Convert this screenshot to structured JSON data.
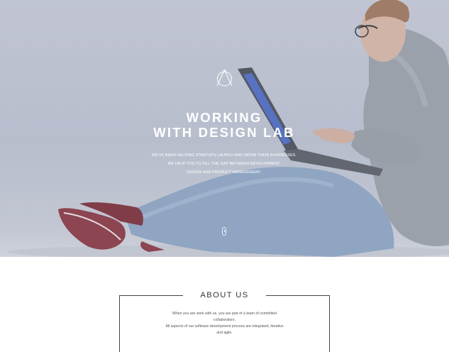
{
  "hero": {
    "title_line1": "WORKING",
    "title_line2": "WITH DESIGN LAB",
    "subtitle_lines": [
      "WE'VE BEEN HELPING STARTUPS LAUNCH AND GROW THEIR BUSINESSES.",
      "WE HELP YOU TO FILL THE GAP BETWEEN DEVELOPMENT,",
      "DESIGN AND PRODUCT MANAGEMENT."
    ],
    "logo_icon": "triangle-circle-logo-icon",
    "scroll_icon": "mouse-scroll-icon"
  },
  "about": {
    "title": "ABOUT US",
    "body_lines": [
      "When you are work with us, you are part of a team of committed",
      "collaborators.",
      "All aspects of our software development process are integrated, iterative",
      "and agile."
    ]
  },
  "colors": {
    "hero_background": "#c3c8d4",
    "hero_text": "#ffffff",
    "about_text": "#333333",
    "frame_line": "#444444"
  }
}
